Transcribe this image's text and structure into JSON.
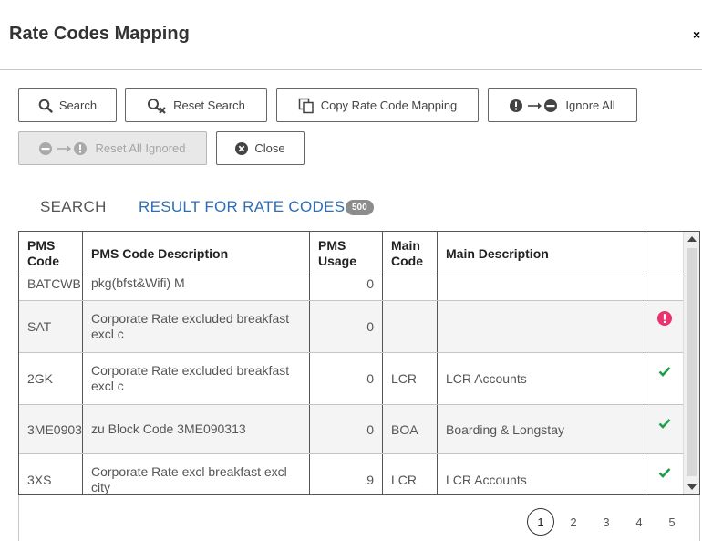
{
  "dialog": {
    "title": "Rate Codes Mapping",
    "close_symbol": "×"
  },
  "toolbar": {
    "search": "Search",
    "reset_search": "Reset Search",
    "copy_mapping": "Copy Rate Code Mapping",
    "ignore_all": "Ignore All",
    "reset_all_ignored": "Reset All Ignored",
    "close": "Close"
  },
  "tabs": {
    "search": "SEARCH",
    "results": "RESULT FOR RATE CODES",
    "results_count": "500"
  },
  "table": {
    "headers": {
      "pms_code_1": "PMS",
      "pms_code_2": "Code",
      "description": "PMS Code Description",
      "usage_1": "PMS",
      "usage_2": "Usage",
      "main_code_1": "Main",
      "main_code_2": "Code",
      "main_description": "Main Description"
    },
    "rows": [
      {
        "pms_code": "BATCWB",
        "description": "pkg(bfst&Wifi) M",
        "usage": "0",
        "main_code": "",
        "main_description": "",
        "status": ""
      },
      {
        "pms_code": "SAT",
        "description": "Corporate Rate excluded breakfast excl c",
        "usage": "0",
        "main_code": "",
        "main_description": "",
        "status": "error"
      },
      {
        "pms_code": "2GK",
        "description": "Corporate Rate excluded breakfast excl c",
        "usage": "0",
        "main_code": "LCR",
        "main_description": "LCR Accounts",
        "status": "mapped"
      },
      {
        "pms_code": "3ME090313",
        "description": "zu Block Code 3ME090313",
        "usage": "0",
        "main_code": "BOA",
        "main_description": "Boarding & Longstay",
        "status": "mapped"
      },
      {
        "pms_code": "3XS",
        "description": "Corporate Rate excl breakfast excl city",
        "usage": "9",
        "main_code": "LCR",
        "main_description": "LCR Accounts",
        "status": "mapped"
      }
    ],
    "status_icons": {
      "error": "exclamation-circle-icon",
      "mapped": "check-icon"
    },
    "colors": {
      "error": "#e8336e",
      "mapped": "#1e9e4a"
    }
  },
  "pagination": {
    "pages": [
      "1",
      "2",
      "3",
      "4",
      "5"
    ],
    "current": "1"
  }
}
